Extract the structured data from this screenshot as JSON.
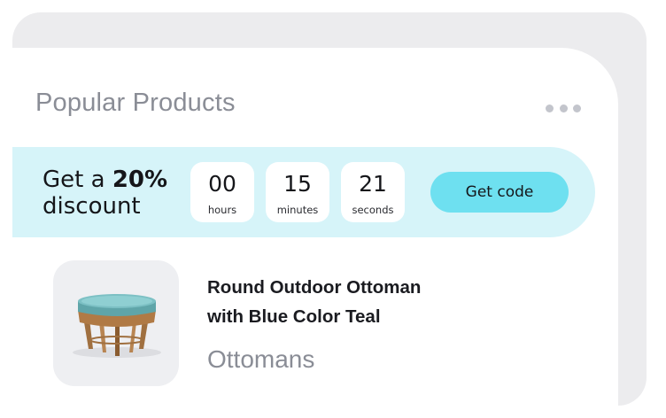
{
  "widget": {
    "title": "Popular Products",
    "more_icon": "more-horizontal-icon"
  },
  "promo": {
    "text_prefix": "Get a ",
    "discount": "20%",
    "text_suffix": "discount",
    "countdown": [
      {
        "value": "00",
        "unit": "hours"
      },
      {
        "value": "15",
        "unit": "minutes"
      },
      {
        "value": "21",
        "unit": "seconds"
      }
    ],
    "button_label": "Get code"
  },
  "product": {
    "name_line1": "Round Outdoor Ottoman",
    "name_line2": "with Blue Color Teal",
    "category": "Ottomans",
    "image_icon": "ottoman-image"
  },
  "colors": {
    "banner_bg": "#d6f4f9",
    "button_bg": "#6ee0f0",
    "title_text": "#8a8d96"
  }
}
